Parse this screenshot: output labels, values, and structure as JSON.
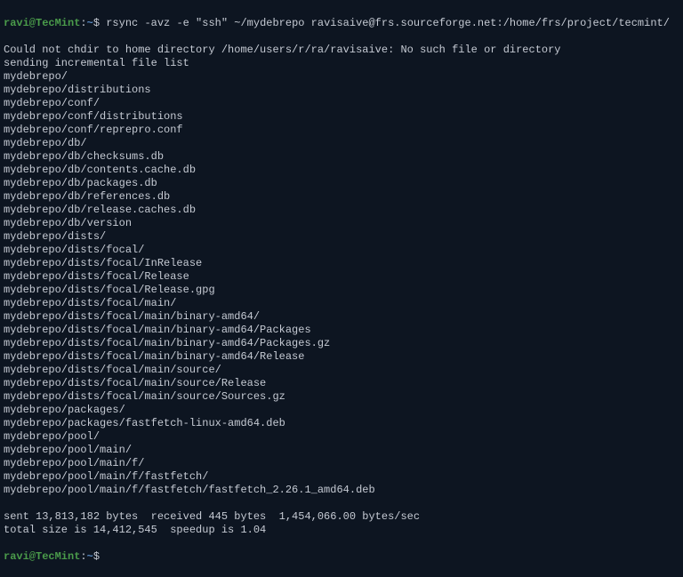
{
  "prompt": {
    "user": "ravi@TecMint",
    "sep": ":",
    "path": "~",
    "dollar": "$ "
  },
  "command": "rsync -avz -e \"ssh\" ~/mydebrepo ravisaive@frs.sourceforge.net:/home/frs/project/tecmint/",
  "lines": [
    "Could not chdir to home directory /home/users/r/ra/ravisaive: No such file or directory",
    "sending incremental file list",
    "mydebrepo/",
    "mydebrepo/distributions",
    "mydebrepo/conf/",
    "mydebrepo/conf/distributions",
    "mydebrepo/conf/reprepro.conf",
    "mydebrepo/db/",
    "mydebrepo/db/checksums.db",
    "mydebrepo/db/contents.cache.db",
    "mydebrepo/db/packages.db",
    "mydebrepo/db/references.db",
    "mydebrepo/db/release.caches.db",
    "mydebrepo/db/version",
    "mydebrepo/dists/",
    "mydebrepo/dists/focal/",
    "mydebrepo/dists/focal/InRelease",
    "mydebrepo/dists/focal/Release",
    "mydebrepo/dists/focal/Release.gpg",
    "mydebrepo/dists/focal/main/",
    "mydebrepo/dists/focal/main/binary-amd64/",
    "mydebrepo/dists/focal/main/binary-amd64/Packages",
    "mydebrepo/dists/focal/main/binary-amd64/Packages.gz",
    "mydebrepo/dists/focal/main/binary-amd64/Release",
    "mydebrepo/dists/focal/main/source/",
    "mydebrepo/dists/focal/main/source/Release",
    "mydebrepo/dists/focal/main/source/Sources.gz",
    "mydebrepo/packages/",
    "mydebrepo/packages/fastfetch-linux-amd64.deb",
    "mydebrepo/pool/",
    "mydebrepo/pool/main/",
    "mydebrepo/pool/main/f/",
    "mydebrepo/pool/main/f/fastfetch/",
    "mydebrepo/pool/main/f/fastfetch/fastfetch_2.26.1_amd64.deb",
    "",
    "sent 13,813,182 bytes  received 445 bytes  1,454,066.00 bytes/sec",
    "total size is 14,412,545  speedup is 1.04"
  ]
}
